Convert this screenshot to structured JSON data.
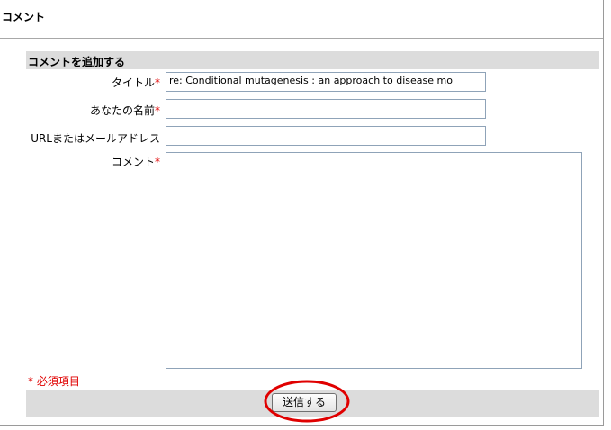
{
  "page": {
    "title": "コメント"
  },
  "form": {
    "header": "コメントを追加する",
    "fields": {
      "title": {
        "label": "タイトル",
        "required_mark": "*",
        "value": "re: Conditional mutagenesis : an approach to disease mo"
      },
      "name": {
        "label": "あなたの名前",
        "required_mark": "*",
        "value": ""
      },
      "url": {
        "label": "URLまたはメールアドレス",
        "value": ""
      },
      "comment": {
        "label": "コメント",
        "required_mark": "*",
        "value": ""
      }
    },
    "required_note": "* 必須項目",
    "submit_label": "送信する"
  },
  "colors": {
    "required": "#e00000",
    "panel_header_bg": "#dcdcdc",
    "input_border": "#8fa3b8",
    "highlight_circle": "#e00000"
  }
}
